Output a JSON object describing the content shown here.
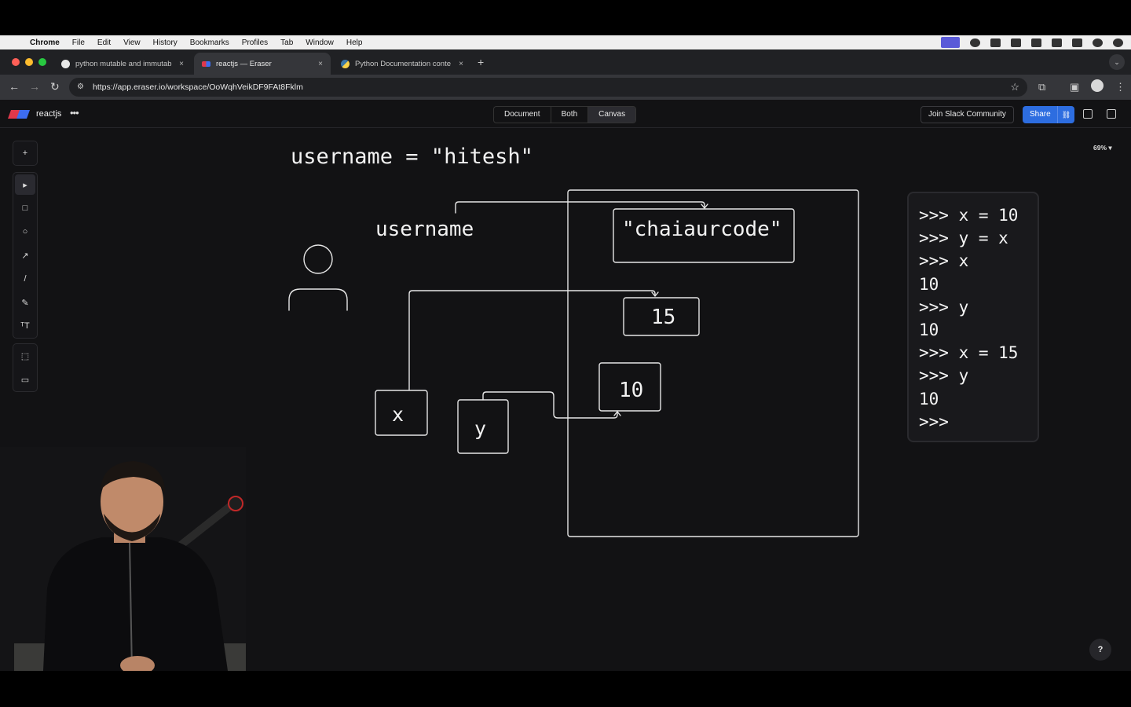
{
  "menubar": {
    "apple_icon": "apple-logo",
    "items": [
      "Chrome",
      "File",
      "Edit",
      "View",
      "History",
      "Bookmarks",
      "Profiles",
      "Tab",
      "Window",
      "Help"
    ]
  },
  "browser": {
    "tabs": [
      {
        "title": "python mutable and immutab",
        "close": "×",
        "favicon": "google-icon"
      },
      {
        "title": "reactjs — Eraser",
        "close": "×",
        "favicon": "eraser-icon"
      },
      {
        "title": "Python Documentation conte",
        "close": "×",
        "favicon": "python-icon"
      }
    ],
    "new_tab": "+",
    "url": "https://app.eraser.io/workspace/OoWqhVeikDF9FAt8Fklm"
  },
  "app": {
    "project_name": "reactjs",
    "more": "•••",
    "view_modes": [
      "Document",
      "Both",
      "Canvas"
    ],
    "selected_view": "Canvas",
    "join_slack": "Join Slack Community",
    "share": "Share",
    "zoom": "69% ▾",
    "help": "?"
  },
  "tools": {
    "add": "+",
    "select": "▸",
    "rectangle": "□",
    "ellipse": "○",
    "arrow": "↗",
    "line": "/",
    "pen": "✎",
    "text": "ᵀT",
    "frame": "⬚",
    "comment": "▭"
  },
  "canvas": {
    "heading": "username = \"hitesh\"",
    "variable_label": "username",
    "string_value": "\"chaiaurcode\"",
    "value_15": "15",
    "value_10": "10",
    "var_x": "x",
    "var_y": "y"
  },
  "terminal": {
    "lines": [
      ">>> x = 10",
      ">>> y = x",
      ">>> x",
      "10",
      ">>> y",
      "10",
      ">>> x = 15",
      ">>> y",
      "10",
      ">>>"
    ]
  },
  "colors": {
    "canvas_bg": "#121214",
    "stroke": "#e6e6e6",
    "accent": "#2d6de0"
  }
}
